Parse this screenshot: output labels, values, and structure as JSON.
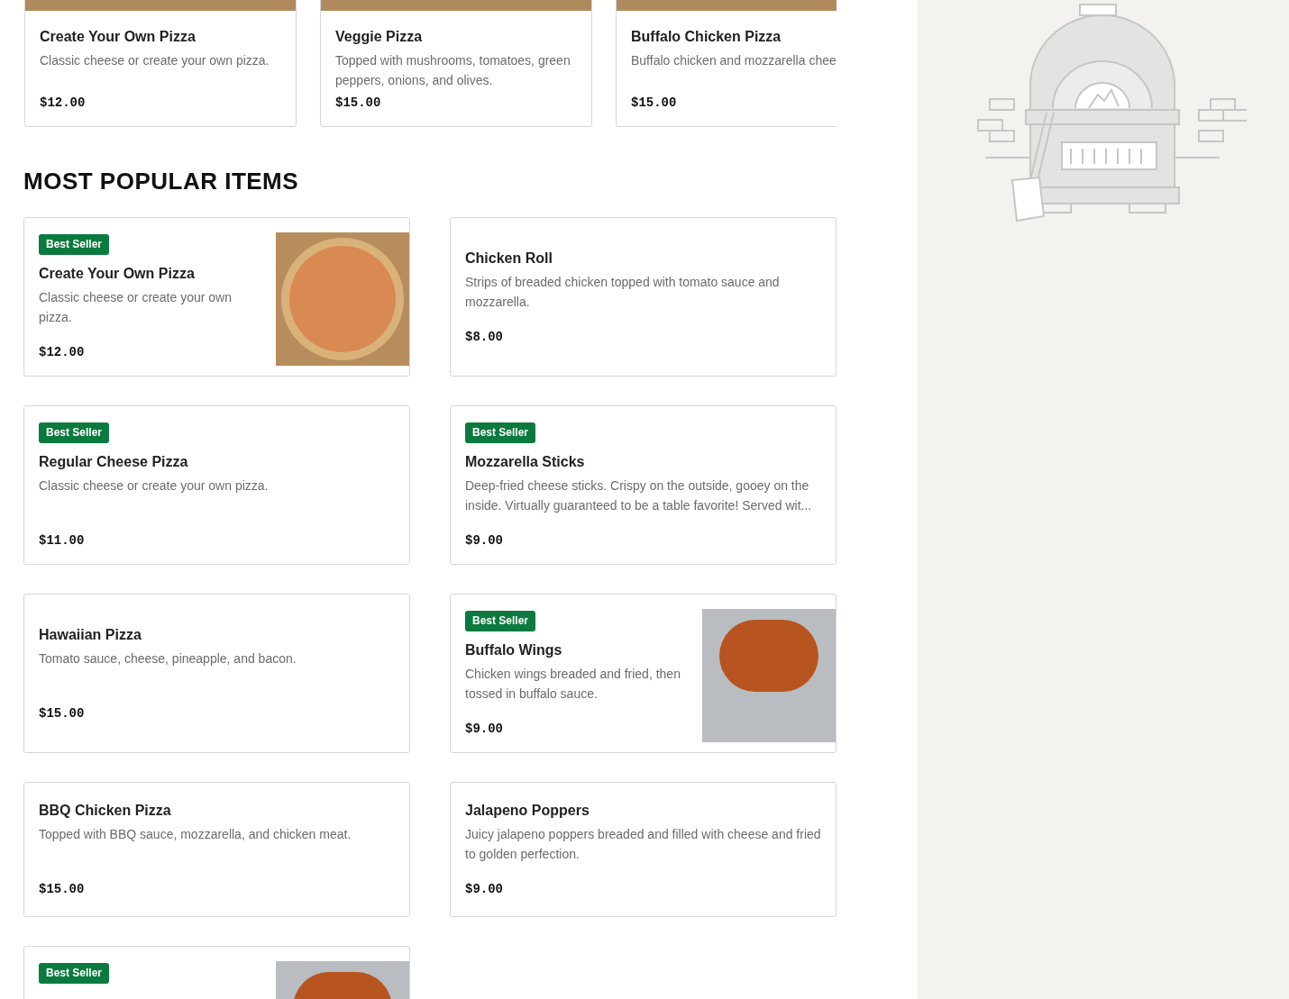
{
  "carousel": [
    {
      "title": "Create Your Own Pizza",
      "description": "Classic cheese or create your own pizza.",
      "price": "$12.00"
    },
    {
      "title": "Veggie Pizza",
      "description": "Topped with mushrooms, tomatoes, green peppers, onions, and olives.",
      "price": "$15.00"
    },
    {
      "title": "Buffalo Chicken Pizza",
      "description": "Buffalo chicken and mozzarella chee",
      "price": "$15.00"
    }
  ],
  "section": {
    "title": "MOST POPULAR ITEMS"
  },
  "items": [
    {
      "badge": "Best Seller",
      "title": "Create Your Own Pizza",
      "description": "Classic cheese or create your own pizza.",
      "price": "$12.00",
      "photo": true
    },
    {
      "title": "Chicken Roll",
      "description": "Strips of breaded chicken topped with tomato sauce and mozzarella.",
      "price": "$8.00"
    },
    {
      "badge": "Best Seller",
      "title": "Regular Cheese Pizza",
      "description": "Classic cheese or create your own pizza.",
      "price": "$11.00"
    },
    {
      "badge": "Best Seller",
      "title": "Mozzarella Sticks",
      "description": "Deep-fried cheese sticks. Crispy on the outside, gooey on the inside. Virtually guaranteed to be a table favorite! Served wit...",
      "price": "$9.00"
    },
    {
      "title": "Hawaiian Pizza",
      "description": "Tomato sauce, cheese, pineapple, and bacon.",
      "price": "$15.00"
    },
    {
      "badge": "Best Seller",
      "title": "Buffalo Wings",
      "description": "Chicken wings breaded and fried, then tossed in buffalo sauce.",
      "price": "$9.00",
      "photo": true
    },
    {
      "title": "BBQ Chicken Pizza",
      "description": "Topped with BBQ sauce, mozzarella, and chicken meat.",
      "price": "$15.00"
    },
    {
      "title": "Jalapeno Poppers",
      "description": "Juicy jalapeno poppers breaded and filled with cheese and fried to golden perfection.",
      "price": "$9.00"
    },
    {
      "badge": "Best Seller",
      "photo": true
    }
  ]
}
